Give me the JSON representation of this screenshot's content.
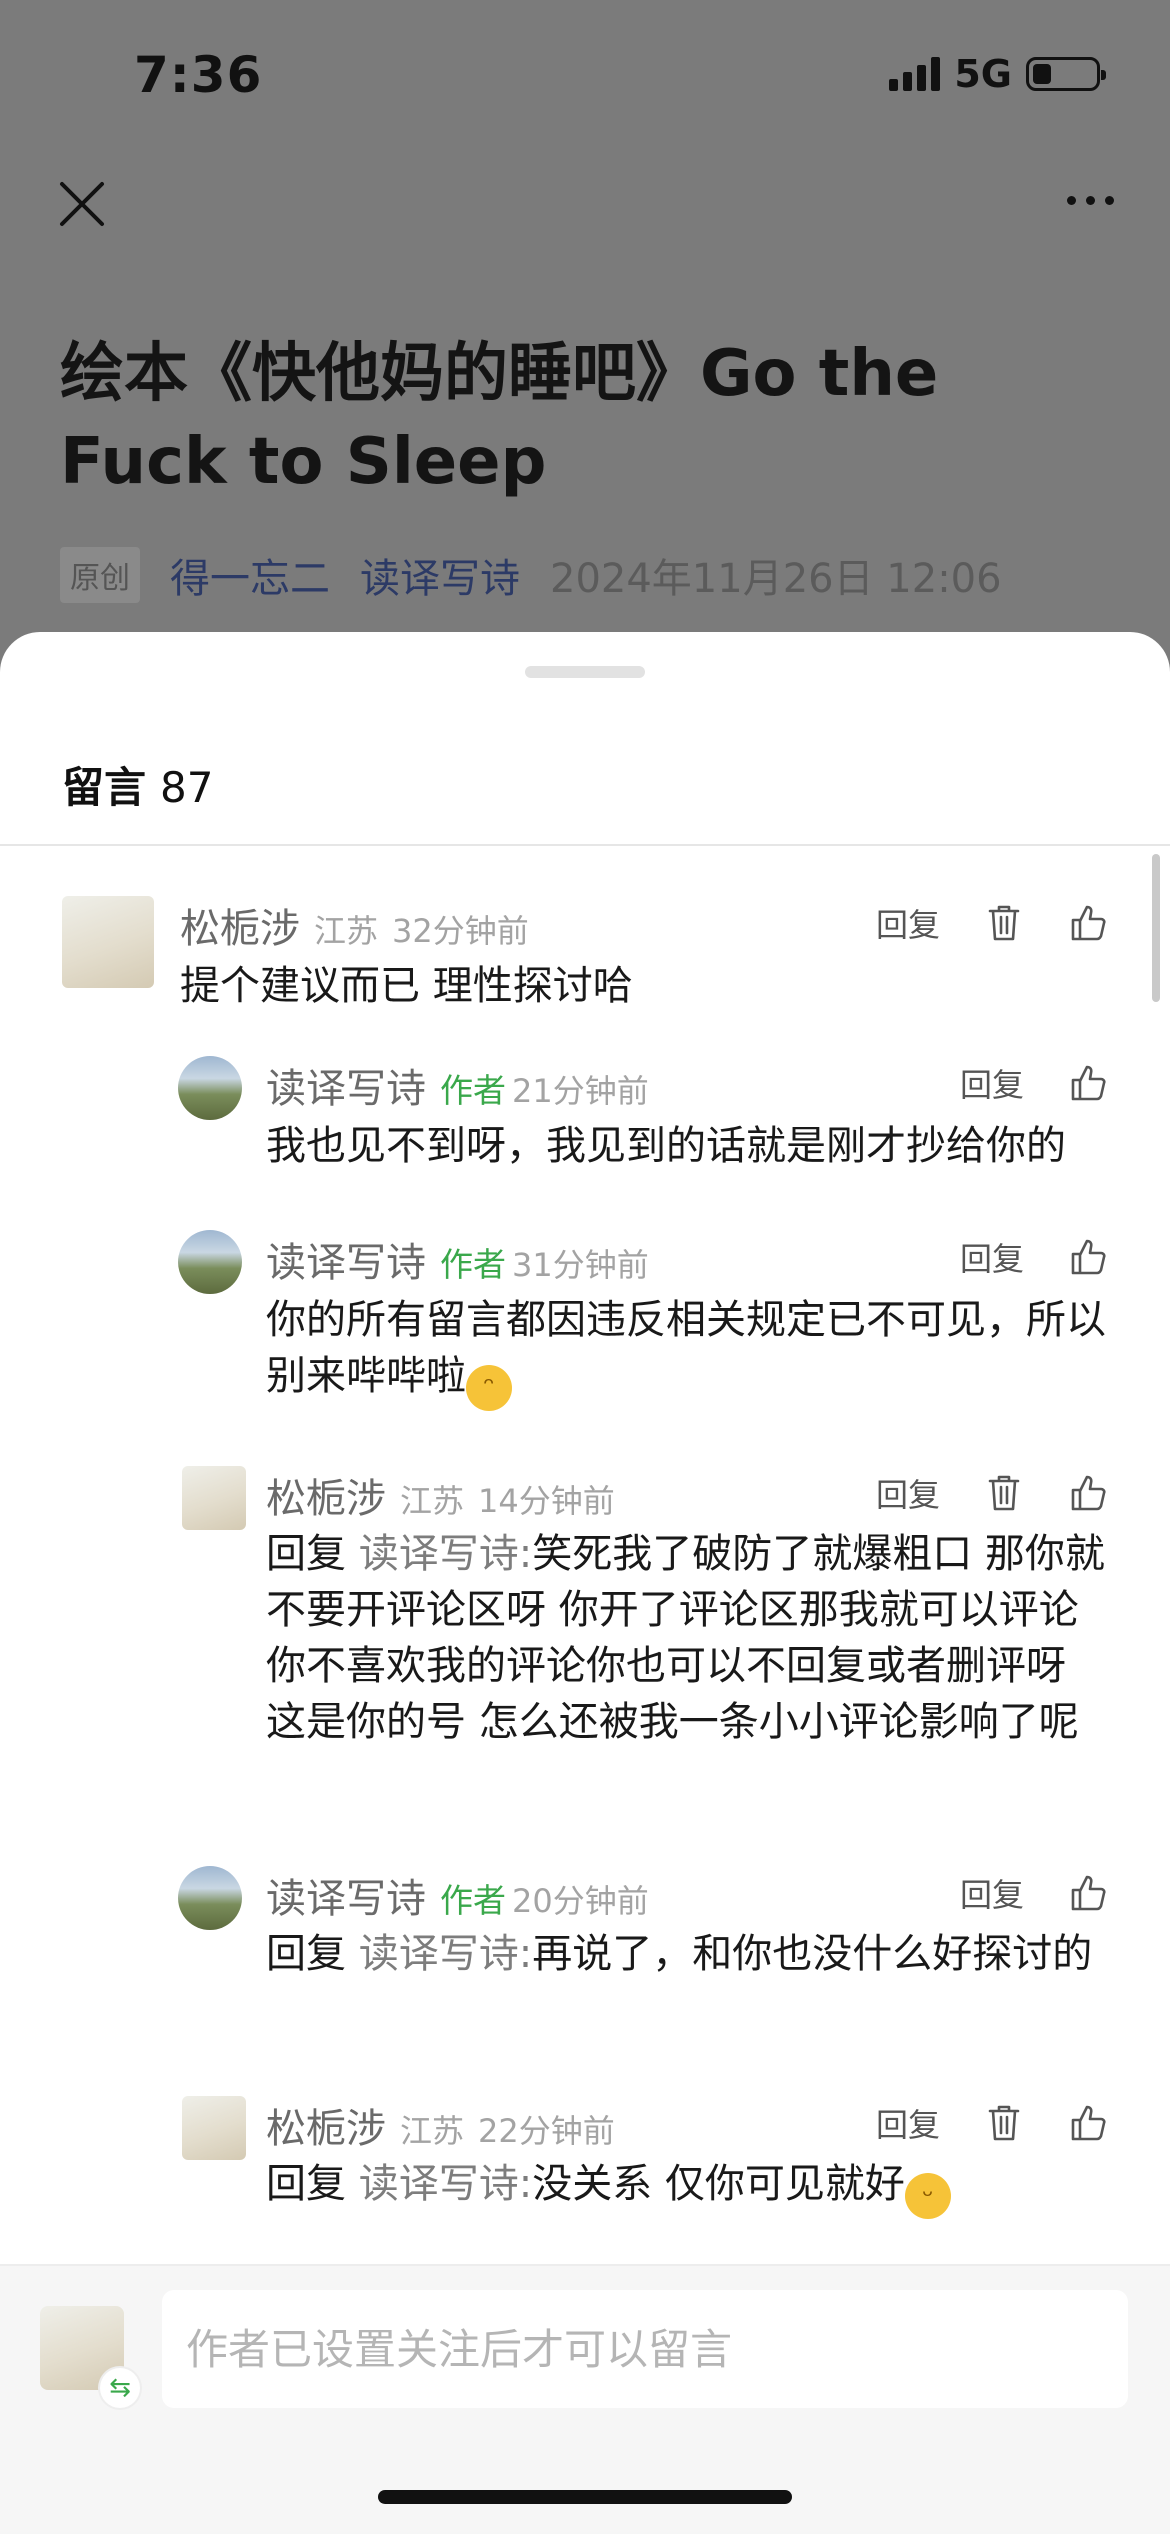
{
  "status_bar": {
    "time": "7:36",
    "network": "5G"
  },
  "article": {
    "title": "绘本《快他妈的睡吧》Go the Fuck to Sleep",
    "original_badge": "原创",
    "author": "得一忘二",
    "account": "读译写诗",
    "date": "2024年11月26日 12:06"
  },
  "comments_panel": {
    "title": "留言",
    "count": "87"
  },
  "comments": [
    {
      "name": "松栀涉",
      "location": "江苏",
      "time": "32分钟前",
      "reply_label": "回复",
      "text": "提个建议而已 理性探讨哈"
    },
    {
      "name": "读译写诗",
      "tag": "作者",
      "time": "21分钟前",
      "reply_label": "回复",
      "text": "我也见不到呀，我见到的话就是刚才抄给你的"
    },
    {
      "name": "读译写诗",
      "tag": "作者",
      "time": "31分钟前",
      "reply_label": "回复",
      "text": "你的所有留言都因违反相关规定已不可见，所以别来哔哔啦",
      "emoji": "grinning-face-emoji"
    },
    {
      "name": "松栀涉",
      "location": "江苏",
      "time": "14分钟前",
      "reply_label": "回复",
      "reply_prefix": "回复",
      "reply_target": "读译写诗:",
      "text": "笑死我了破防了就爆粗口 那你就不要开评论区呀  你开了评论区那我就可以评论 你不喜欢我的评论你也可以不回复或者删评呀 这是你的号 怎么还被我一条小小评论影响了呢"
    },
    {
      "name": "读译写诗",
      "tag": "作者",
      "time": "20分钟前",
      "reply_label": "回复",
      "reply_prefix": "回复",
      "reply_target": "读译写诗:",
      "text": "再说了，和你也没什么好探讨的"
    },
    {
      "name": "松栀涉",
      "location": "江苏",
      "time": "22分钟前",
      "reply_label": "回复",
      "reply_prefix": "回复",
      "reply_target": "读译写诗:",
      "text": "没关系 仅你可见就好",
      "emoji": "winking-face-tongue-emoji"
    }
  ],
  "input": {
    "placeholder": "作者已设置关注后才可以留言"
  },
  "colors": {
    "author_tag": "#3aa84b",
    "account_link": "#2c3a66",
    "dim_overlay": "#7b7b7b"
  }
}
